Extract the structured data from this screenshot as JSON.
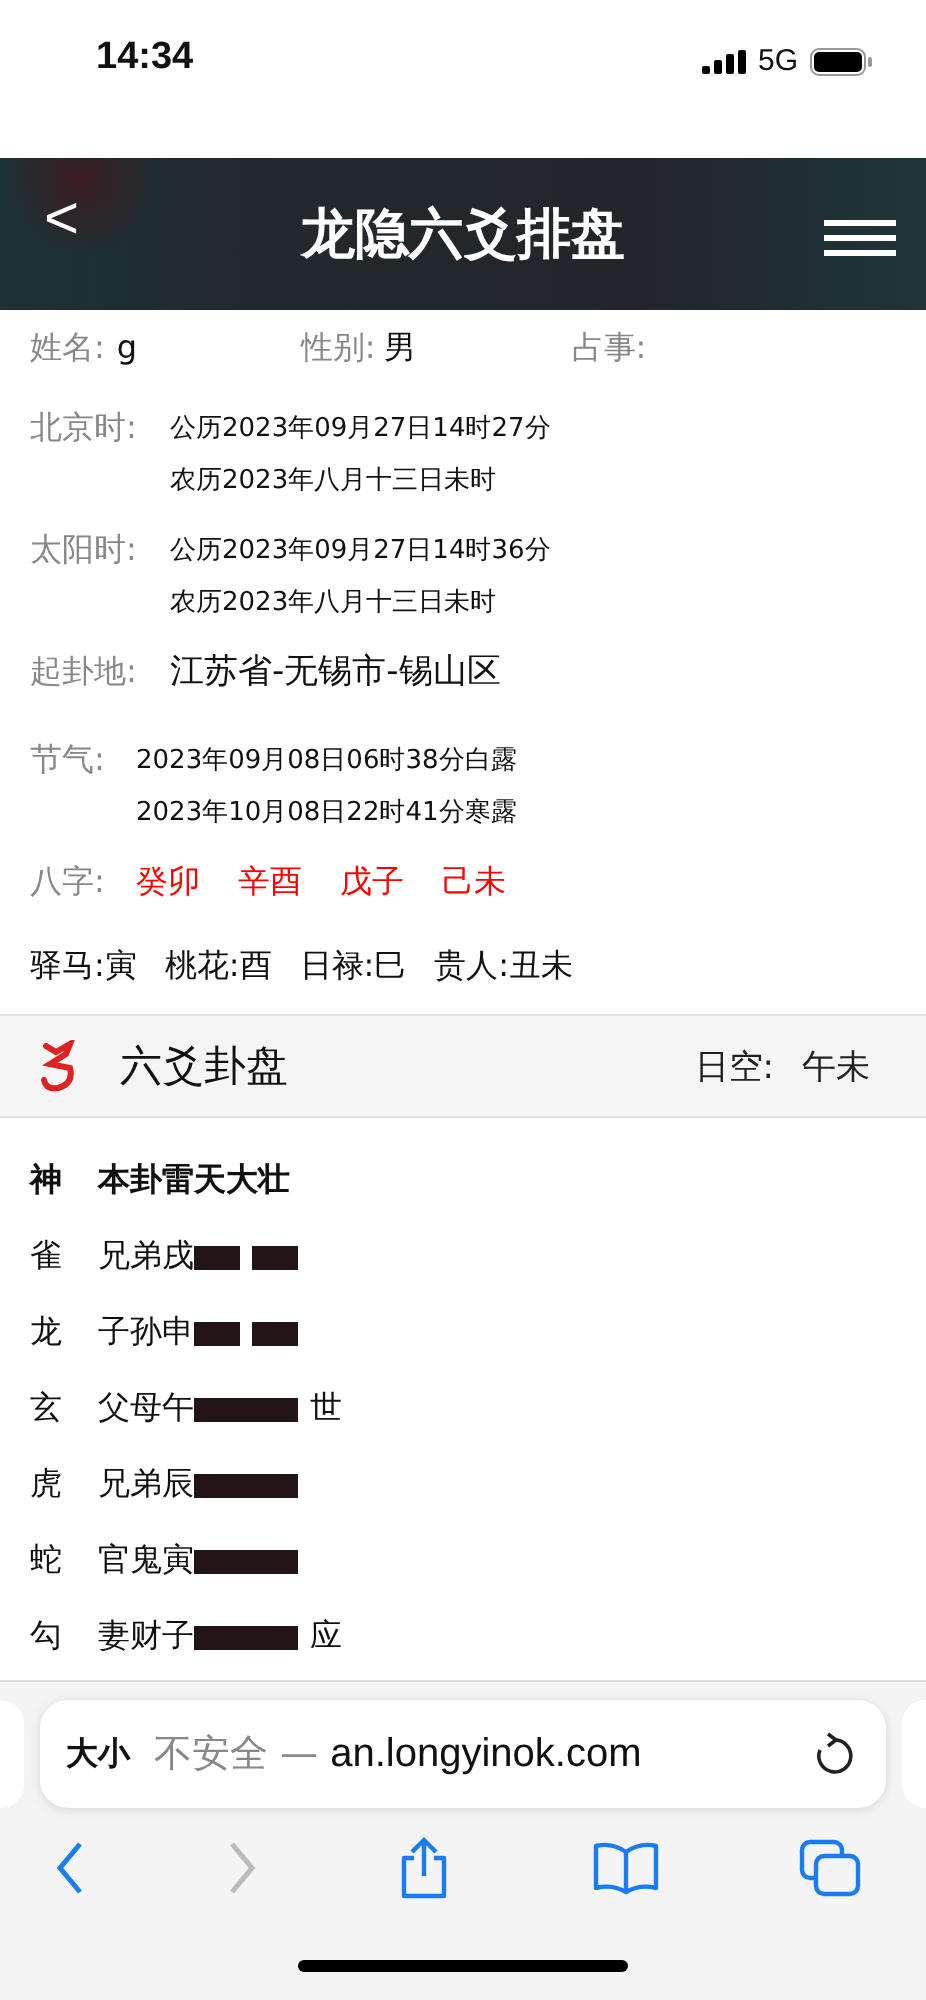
{
  "status_bar": {
    "time": "14:34",
    "network": "5G"
  },
  "header": {
    "back": "<",
    "title": "龙隐六爻排盘"
  },
  "info": {
    "name_label": "姓名:",
    "name": "g",
    "gender_label": "性别:",
    "gender": "男",
    "matter_label": "占事:"
  },
  "times": [
    {
      "label": "北京时:",
      "lines": [
        "公历2023年09月27日14时27分",
        "农历2023年八月十三日未时"
      ]
    },
    {
      "label": "太阳时:",
      "lines": [
        "公历2023年09月27日14时36分",
        "农历2023年八月十三日未时"
      ]
    }
  ],
  "place": {
    "label": "起卦地:",
    "value": "江苏省-无锡市-锡山区"
  },
  "solar_terms": {
    "label": "节气:",
    "lines": [
      "2023年09月08日06时38分白露",
      "2023年10月08日22时41分寒露"
    ]
  },
  "bazi": {
    "label": "八字:",
    "pillars": [
      "癸卯",
      "辛酉",
      "戊子",
      "己未"
    ]
  },
  "stars": [
    "驿马:寅",
    "桃花:酉",
    "日禄:巳",
    "贵人:丑未"
  ],
  "section": {
    "title": "六爻卦盘",
    "void_label": "日空:",
    "void": "午未"
  },
  "hexagram": {
    "spirit_header": "神",
    "name": "本卦雷天大壮",
    "lines": [
      {
        "spirit": "雀",
        "relation": "兄弟戌",
        "kind": "yin"
      },
      {
        "spirit": "龙",
        "relation": "子孙申",
        "kind": "yin"
      },
      {
        "spirit": "玄",
        "relation": "父母午",
        "kind": "yang",
        "mark": "世"
      },
      {
        "spirit": "虎",
        "relation": "兄弟辰",
        "kind": "yang"
      },
      {
        "spirit": "蛇",
        "relation": "官鬼寅",
        "kind": "yang"
      },
      {
        "spirit": "勾",
        "relation": "妻财子",
        "kind": "yang",
        "mark": "应"
      }
    ]
  },
  "browser": {
    "text_size": "大小",
    "insecure": "不安全 — ",
    "url": "an.longyinok.com",
    "back_enabled": true,
    "forward_enabled": false
  }
}
